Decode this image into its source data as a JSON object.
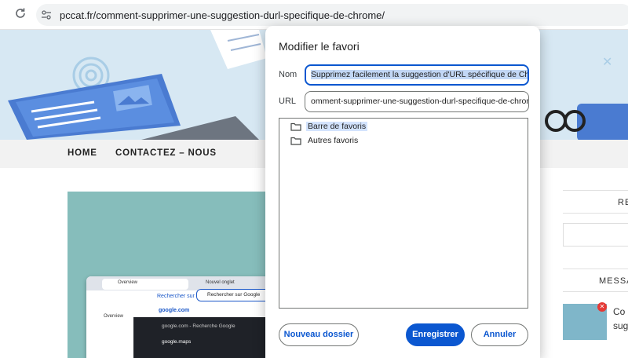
{
  "browser": {
    "url": "pccat.fr/comment-supprimer-une-suggestion-durl-specifique-de-chrome/"
  },
  "site": {
    "nav": {
      "home": "HOME",
      "contact": "CONTACTEZ – NOUS"
    },
    "sidebar": {
      "widget1_title": "RE",
      "widget2_title": "MESSA",
      "post_title_line1": "Co",
      "post_title_line2": "sug"
    },
    "hero_screenshot": {
      "tab_overview": "Overview",
      "tab_new": "Nouvel onglet",
      "search_suggestion": "Rechercher sur Google",
      "search_box": "Rechercher sur Google",
      "google_domain": "google.com",
      "google_search_row": "google.com - Recherche Google",
      "google_maps": "google.maps",
      "overview_small": "Overview"
    }
  },
  "dialog": {
    "title": "Modifier le favori",
    "name_label": "Nom",
    "name_value": "Supprimez facilement la suggestion d'URL spécifique de Chrome",
    "url_label": "URL",
    "url_value": "omment-supprimer-une-suggestion-durl-specifique-de-chrome/",
    "folders": [
      {
        "label": "Barre de favoris",
        "selected": true
      },
      {
        "label": "Autres favoris",
        "selected": false
      }
    ],
    "new_folder_button": "Nouveau dossier",
    "save_button": "Enregistrer",
    "cancel_button": "Annuler"
  },
  "colors": {
    "accent": "#0b57d0",
    "banner": "#d7e8f3",
    "hero": "#86bdbb"
  }
}
